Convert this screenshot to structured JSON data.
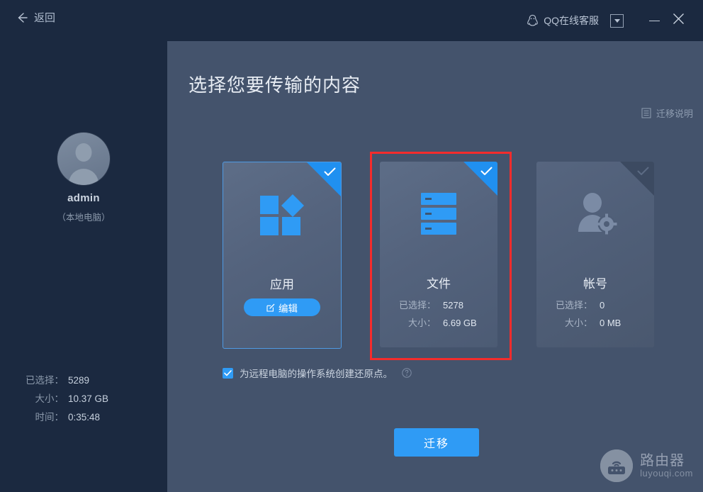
{
  "titlebar": {
    "back_label": "返回",
    "back_icon": "arrow-left-icon",
    "qq_label": "QQ在线客服",
    "qq_icon": "qq-penguin-icon",
    "dropdown_icon": "chevron-down-icon",
    "minimize_icon": "minimize-icon",
    "close_icon": "close-icon"
  },
  "sidebar": {
    "avatar_icon": "user-avatar-icon",
    "user_name": "admin",
    "user_sub": "（本地电脑）",
    "stats": [
      {
        "label": "已选择：",
        "value": "5289"
      },
      {
        "label": "大小：",
        "value": "10.37 GB"
      },
      {
        "label": "时间：",
        "value": "0:35:48"
      }
    ]
  },
  "main": {
    "title": "选择您要传输的内容",
    "help_link": "迁移说明",
    "help_link_icon": "document-icon",
    "cards": [
      {
        "name": "应用",
        "icon": "apps-grid-icon",
        "selected": "true",
        "edit_label": "编辑",
        "edit_icon": "edit-square-icon",
        "check_icon": "check-icon"
      },
      {
        "name": "文件",
        "icon": "server-stack-icon",
        "selected": "true",
        "check_icon": "check-icon",
        "stats": [
          {
            "label": "已选择：",
            "value": "5278"
          },
          {
            "label": "大小：",
            "value": "6.69 GB"
          }
        ]
      },
      {
        "name": "帐号",
        "icon": "user-settings-icon",
        "selected": "false",
        "check_icon": "check-icon",
        "stats": [
          {
            "label": "已选择：",
            "value": "0"
          },
          {
            "label": "大小：",
            "value": "0 MB"
          }
        ]
      }
    ],
    "option": {
      "label": "为远程电脑的操作系统创建还原点。",
      "checked": "true",
      "checkbox_icon": "checkbox-checked-icon",
      "help_icon": "question-mark-icon"
    },
    "primary_button": "迁移"
  },
  "watermark": {
    "icon": "router-icon",
    "cn": "路由器",
    "en": "luyouqi.com"
  },
  "colors": {
    "accent": "#2f9bf5",
    "highlight_box": "#f42c2c",
    "sidebar_bg": "#1b2940",
    "main_bg": "#44536c"
  }
}
